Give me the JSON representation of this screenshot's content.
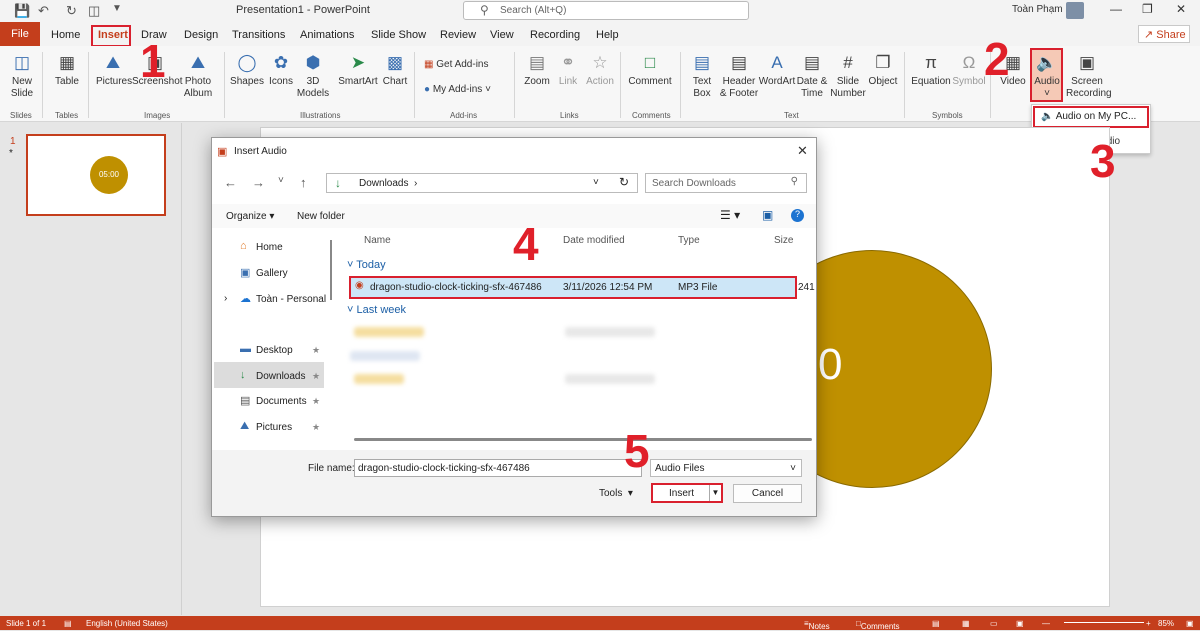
{
  "titlebar": {
    "title": "Presentation1 - PowerPoint",
    "search_placeholder": "Search (Alt+Q)",
    "user": "Toàn Phạm"
  },
  "tabs": [
    "File",
    "Home",
    "Insert",
    "Draw",
    "Design",
    "Transitions",
    "Animations",
    "Slide Show",
    "Review",
    "View",
    "Recording",
    "Help"
  ],
  "share_label": "Share",
  "ribbon": {
    "new_slide": "New\nSlide",
    "table": "Table",
    "pictures": "Pictures",
    "screenshot": "Screenshot",
    "photo_album": "Photo\nAlbum",
    "shapes": "Shapes",
    "icons": "Icons",
    "models": "3D\nModels",
    "smartart": "SmartArt",
    "chart": "Chart",
    "get_addins": "Get Add-ins",
    "my_addins": "My Add-ins",
    "zoom": "Zoom",
    "link": "Link",
    "action": "Action",
    "comment": "Comment",
    "text_box": "Text\nBox",
    "header_footer": "Header\n& Footer",
    "wordart": "WordArt",
    "date_time": "Date &\nTime",
    "slide_number": "Slide\nNumber",
    "object": "Object",
    "equation": "Equation",
    "symbol": "Symbol",
    "video": "Video",
    "audio": "Audio",
    "screen_recording": "Screen\nRecording",
    "groups": [
      "Slides",
      "Tables",
      "Images",
      "Illustrations",
      "Add-ins",
      "Links",
      "Comments",
      "Text",
      "Symbols"
    ]
  },
  "audio_menu": {
    "item1": "Audio on My PC...",
    "item2": "Record Audio"
  },
  "slides_panel": {
    "number": "1",
    "star": "*",
    "timer": "05:00"
  },
  "slide": {
    "digit": "0"
  },
  "dialog": {
    "title": "Insert Audio",
    "path": "Downloads",
    "search_placeholder": "Search Downloads",
    "organize": "Organize",
    "new_folder": "New folder",
    "nav": [
      "Home",
      "Gallery",
      "Toàn - Personal",
      "Desktop",
      "Downloads",
      "Documents",
      "Pictures"
    ],
    "columns": [
      "Name",
      "Date modified",
      "Type",
      "Size"
    ],
    "group_today": "Today",
    "group_lastweek": "Last week",
    "file": {
      "name": "dragon-studio-clock-ticking-sfx-467486",
      "date": "3/11/2026 12:54 PM",
      "type": "MP3 File",
      "size": "241"
    },
    "filename_label": "File name:",
    "filename_value": "dragon-studio-clock-ticking-sfx-467486",
    "filter": "Audio Files",
    "tools": "Tools",
    "insert": "Insert",
    "cancel": "Cancel"
  },
  "status": {
    "slide": "Slide 1 of 1",
    "language": "English (United States)",
    "notes": "Notes",
    "comments": "Comments",
    "zoom": "85%"
  },
  "steps": [
    "1",
    "2",
    "3",
    "4",
    "5"
  ]
}
